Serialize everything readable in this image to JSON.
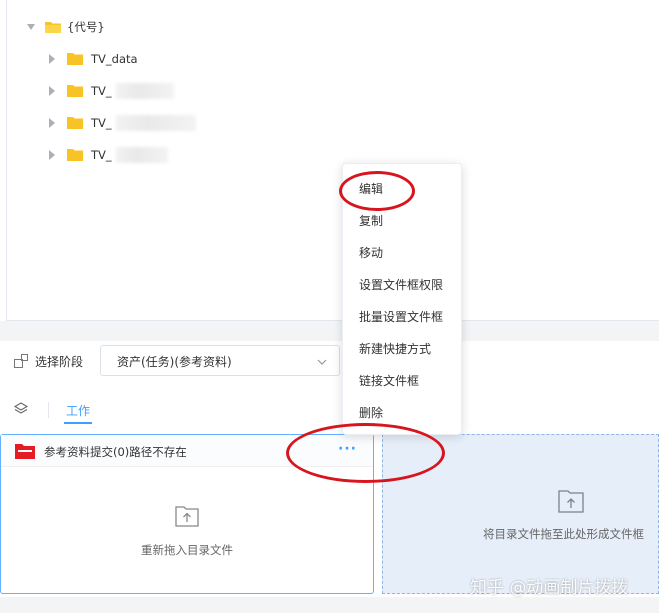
{
  "tree": {
    "root": {
      "label": "{代号}"
    },
    "children": [
      {
        "label": "TV_data"
      },
      {
        "label": "TV_"
      },
      {
        "label": "TV_"
      },
      {
        "label": "TV_"
      }
    ]
  },
  "stage": {
    "label": "选择阶段",
    "selected": "资产(任务)(参考资料)"
  },
  "tabs": {
    "work": "工作"
  },
  "card": {
    "title": "参考资料提交(0)路径不存在",
    "more": "···",
    "upload_text": "重新拖入目录文件"
  },
  "dropzone": {
    "text": "将目录文件拖至此处形成文件框"
  },
  "context_menu": {
    "items": [
      "编辑",
      "复制",
      "移动",
      "设置文件框权限",
      "批量设置文件框",
      "新建快捷方式",
      "链接文件框",
      "删除"
    ]
  },
  "watermark": "知乎 @动画制片拨拨",
  "colors": {
    "accent": "#409eff",
    "folder": "#f7c325",
    "annotation": "#d7151c",
    "card_folder": "#e51c23"
  }
}
